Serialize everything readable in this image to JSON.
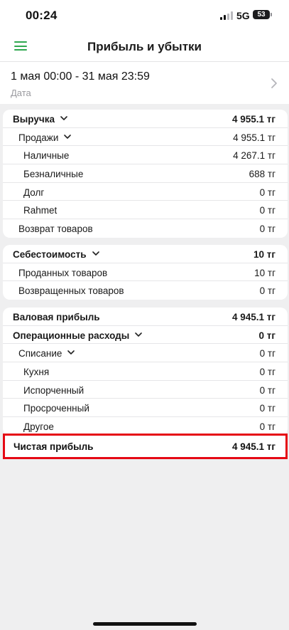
{
  "status_bar": {
    "time": "00:24",
    "network": "5G",
    "battery": "53"
  },
  "header": {
    "title": "Прибыль и убытки"
  },
  "date": {
    "range": "1 мая 00:00 - 31 мая 23:59",
    "caption": "Дата"
  },
  "revenue": {
    "title": "Выручка",
    "total": "4 955.1 тг",
    "sales": {
      "label": "Продажи",
      "value": "4 955.1 тг"
    },
    "cash": {
      "label": "Наличные",
      "value": "4 267.1 тг"
    },
    "cashless": {
      "label": "Безналичные",
      "value": "688 тг"
    },
    "debt": {
      "label": "Долг",
      "value": "0 тг"
    },
    "rahmet": {
      "label": "Rahmet",
      "value": "0 тг"
    },
    "returns": {
      "label": "Возврат товаров",
      "value": "0 тг"
    }
  },
  "cost": {
    "title": "Себестоимость",
    "total": "10 тг",
    "sold": {
      "label": "Проданных товаров",
      "value": "10 тг"
    },
    "returned": {
      "label": "Возвращенных товаров",
      "value": "0 тг"
    }
  },
  "profit": {
    "gross": {
      "label": "Валовая прибыль",
      "value": "4 945.1 тг"
    },
    "opex": {
      "label": "Операционные расходы",
      "value": "0 тг"
    },
    "writeoff": {
      "label": "Списание",
      "value": "0 тг"
    },
    "kitchen": {
      "label": "Кухня",
      "value": "0 тг"
    },
    "spoiled": {
      "label": "Испорченный",
      "value": "0 тг"
    },
    "expired": {
      "label": "Просроченный",
      "value": "0 тг"
    },
    "other": {
      "label": "Другое",
      "value": "0 тг"
    }
  },
  "net_profit": {
    "label": "Чистая прибыль",
    "value": "4 945.1 тг"
  },
  "colors": {
    "accent": "#2fa84f",
    "highlight": "#e50914",
    "background": "#efeff0"
  },
  "icons": {
    "menu": "hamburger-menu-icon",
    "chevron_right": "chevron-right-icon",
    "chevron_down": "chevron-down-icon"
  }
}
